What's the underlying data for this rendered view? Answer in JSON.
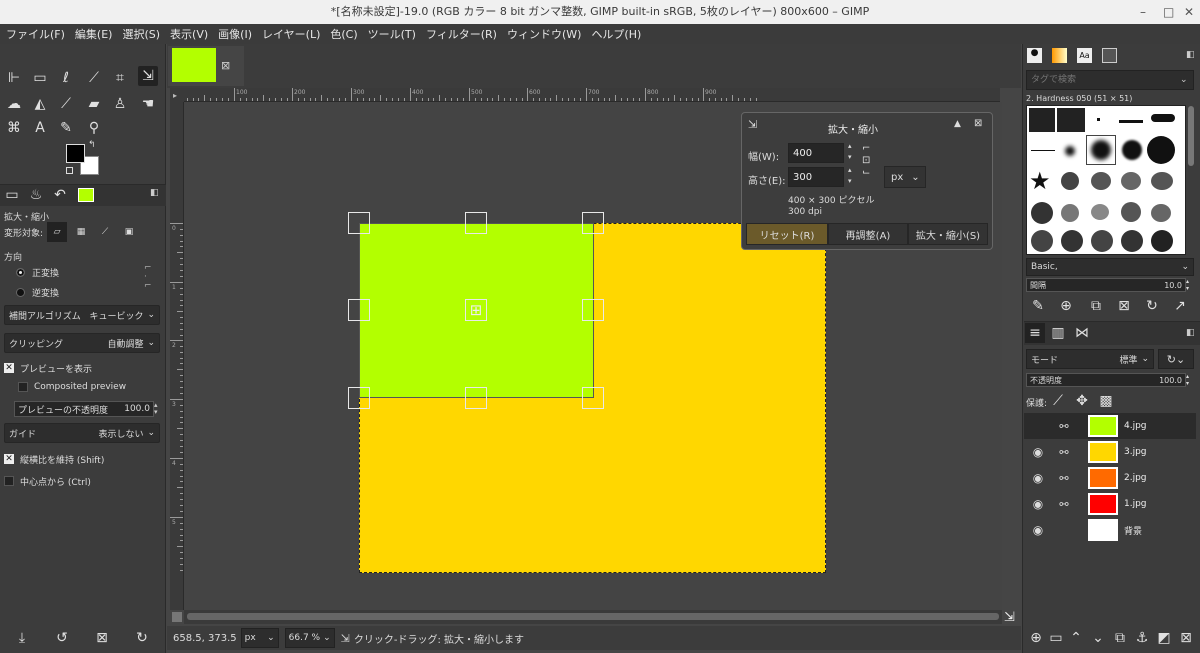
{
  "window": {
    "title": "*[名称未設定]-19.0 (RGB カラー 8 bit ガンマ整数, GIMP built-in sRGB, 5枚のレイヤー) 800x600 – GIMP"
  },
  "menu": [
    "ファイル(F)",
    "編集(E)",
    "選択(S)",
    "表示(V)",
    "画像(I)",
    "レイヤー(L)",
    "色(C)",
    "ツール(T)",
    "フィルター(R)",
    "ウィンドウ(W)",
    "ヘルプ(H)"
  ],
  "tool_options": {
    "title": "拡大・縮小",
    "transform_label": "変形対象:",
    "direction_label": "方向",
    "direction_normal": "正変換",
    "direction_corrective": "逆変換",
    "interpolation_label": "補間アルゴリズム",
    "interpolation_value": "キュービック",
    "clipping_label": "クリッピング",
    "clipping_value": "自動調整",
    "show_preview": "プレビューを表示",
    "composited_preview": "Composited preview",
    "preview_opacity_label": "プレビューの不透明度",
    "preview_opacity_value": "100.0",
    "guides_label": "ガイド",
    "guides_value": "表示しない",
    "keep_aspect": "縦横比を維持 (Shift)",
    "from_center": "中心点から (Ctrl)"
  },
  "ruler": {
    "top": [
      "-200",
      "-100",
      "0",
      "100",
      "200",
      "300",
      "400",
      "500",
      "600",
      "700",
      "800",
      "900"
    ],
    "left": [
      "0",
      "1",
      "2",
      "3",
      "4",
      "5"
    ]
  },
  "status": {
    "coords": "658.5, 373.5",
    "unit": "px",
    "zoom": "66.7 %",
    "message": "クリック-ドラッグ: 拡大・縮小します"
  },
  "scale_dialog": {
    "title": "拡大・縮小",
    "width_label": "幅(W):",
    "width_value": "400",
    "height_label": "高さ(E):",
    "height_value": "300",
    "unit": "px",
    "size_info": "400 × 300 ピクセル",
    "resolution": "300 dpi",
    "reset_button": "リセット(R)",
    "readjust_button": "再調整(A)",
    "scale_button": "拡大・縮小(S)"
  },
  "brushes": {
    "search_placeholder": "タグで検索",
    "current": "2. Hardness 050 (51 × 51)",
    "tag": "Basic,",
    "spacing_label": "間隔",
    "spacing_value": "10.0"
  },
  "layers_panel": {
    "mode_label": "モード",
    "mode_value": "標準",
    "opacity_label": "不透明度",
    "opacity_value": "100.0",
    "lock_label": "保護:"
  },
  "layers": [
    {
      "name": "4.jpg",
      "color": "#b3ff00",
      "visible": false,
      "selected": true
    },
    {
      "name": "3.jpg",
      "color": "#ffd700",
      "visible": true,
      "selected": false
    },
    {
      "name": "2.jpg",
      "color": "#ff6a00",
      "visible": true,
      "selected": false
    },
    {
      "name": "1.jpg",
      "color": "#ff0000",
      "visible": true,
      "selected": false
    },
    {
      "name": "背景",
      "color": "#ffffff",
      "visible": true,
      "selected": false
    }
  ],
  "colors": {
    "fg": "#000000",
    "bg": "#ffffff",
    "layer_top": "#b3ff00",
    "layer_yellow": "#ffd700"
  }
}
